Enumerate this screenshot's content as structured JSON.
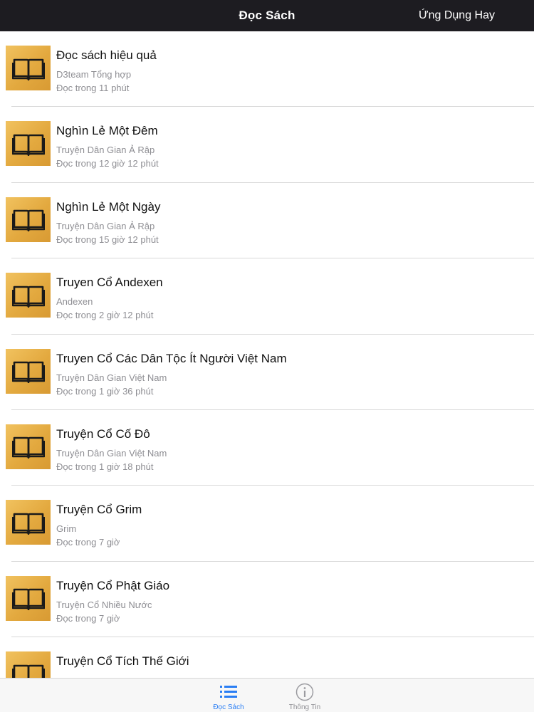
{
  "navbar": {
    "title": "Đọc Sách",
    "right_button": "Ứng Dụng Hay"
  },
  "books": [
    {
      "title": "Đọc sách hiệu quả",
      "author": "D3team Tổng hợp",
      "read_time": "Đọc trong 11 phút"
    },
    {
      "title": "Nghìn Lẻ Một Đêm",
      "author": "Truyện Dân Gian Ả Rập",
      "read_time": "Đọc trong 12 giờ 12 phút"
    },
    {
      "title": "Nghìn Lẻ Một Ngày",
      "author": "Truyện Dân Gian Ả Rập",
      "read_time": "Đọc trong 15 giờ 12 phút"
    },
    {
      "title": "Truyen Cổ Andexen",
      "author": "Andexen",
      "read_time": "Đọc trong 2 giờ 12 phút"
    },
    {
      "title": "Truyen Cổ Các Dân Tộc Ít Người Việt Nam",
      "author": "Truyện Dân Gian Việt Nam",
      "read_time": "Đọc trong 1 giờ 36 phút"
    },
    {
      "title": "Truyện Cổ Cố Đô",
      "author": "Truyện Dân Gian Việt Nam",
      "read_time": "Đọc trong 1 giờ 18 phút"
    },
    {
      "title": "Truyện Cổ Grim",
      "author": "Grim",
      "read_time": "Đọc trong 7 giờ"
    },
    {
      "title": "Truyện Cổ Phật Giáo",
      "author": "Truyện Cổ Nhiều Nước",
      "read_time": "Đọc trong 7 giờ"
    },
    {
      "title": "Truyện Cổ Tích Thế Giới",
      "author": "",
      "read_time": ""
    }
  ],
  "book_icon": "open-book-icon",
  "tabbar": {
    "tabs": [
      {
        "label": "Đọc Sách",
        "icon": "list-icon",
        "active": true
      },
      {
        "label": "Thông Tin",
        "icon": "info-icon",
        "active": false
      }
    ]
  },
  "colors": {
    "navbar_bg": "#1d1c21",
    "accent": "#2a7ef4",
    "thumb": "#e9b24c",
    "secondary_text": "#8e8e93"
  }
}
